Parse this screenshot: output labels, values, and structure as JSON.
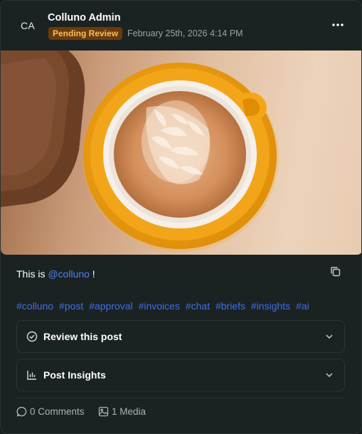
{
  "post": {
    "avatar_initials": "CA",
    "author": "Colluno Admin",
    "status": "Pending Review",
    "timestamp": "February 25th, 2026 4:14 PM",
    "caption_prefix": "This is ",
    "mention": "@colluno",
    "caption_suffix": " !",
    "hashtags": [
      "#colluno",
      "#post",
      "#approval",
      "#invoices",
      "#chat",
      "#briefs",
      "#insights",
      "#ai"
    ]
  },
  "sections": {
    "review_label": "Review this post",
    "insights_label": "Post Insights"
  },
  "footer": {
    "comments": "0 Comments",
    "media": "1 Media"
  },
  "icons": {
    "more": "more-horizontal-icon",
    "copy": "copy-icon",
    "review": "check-circle-icon",
    "insights": "bar-chart-icon",
    "chevron": "chevron-down-icon",
    "comments": "comment-icon",
    "media": "image-icon"
  },
  "colors": {
    "badge_bg": "#6b3a0c",
    "badge_text": "#f6c25a",
    "link": "#3e6fe6",
    "card_bg": "#1b2222"
  }
}
